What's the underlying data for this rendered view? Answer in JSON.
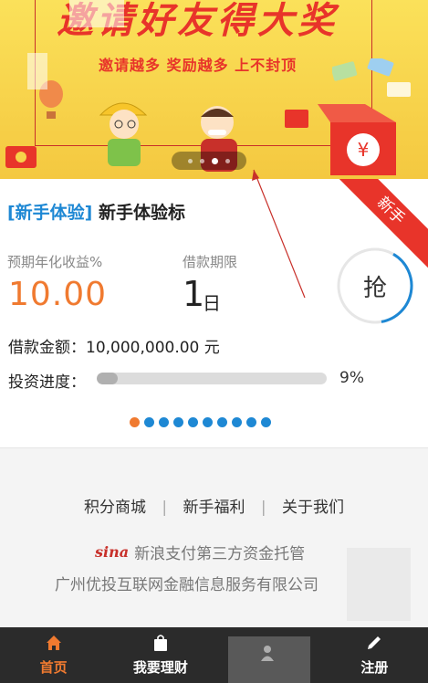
{
  "banner": {
    "title": "邀请好友得大奖",
    "subtitle": "邀请越多 奖励越多 上不封顶",
    "slide_count": 4,
    "active_slide": 3
  },
  "product": {
    "tag": "[新手体验]",
    "name": "新手体验标",
    "ribbon": "新手",
    "rate_label": "预期年化收益%",
    "rate_value": "10.00",
    "term_label": "借款期限",
    "term_value": "1",
    "term_unit": "日",
    "buy_label": "抢",
    "amount_label": "借款金额：",
    "amount_value": "10,000,000.00 元",
    "progress_label": "投资进度：",
    "progress_value": 9,
    "progress_text": "9%",
    "page_count": 10,
    "active_page": 0
  },
  "footer": {
    "links": [
      "积分商城",
      "新手福利",
      "关于我们"
    ],
    "separator": "|",
    "sina_logo": "sina",
    "sina_text": "新浪支付第三方资金托管",
    "company": "广州优投互联网金融信息服务有限公司"
  },
  "tabs": [
    {
      "label": "首页",
      "icon": "home-icon",
      "active": true
    },
    {
      "label": "我要理财",
      "icon": "bag-icon",
      "active": false
    },
    {
      "label": "",
      "icon": "person-icon",
      "active": false
    },
    {
      "label": "注册",
      "icon": "pencil-icon",
      "active": false
    }
  ],
  "colors": {
    "accent": "#f07a30",
    "blue": "#1e88d4",
    "red": "#e8342a",
    "tabbar": "#2b2b2b"
  }
}
